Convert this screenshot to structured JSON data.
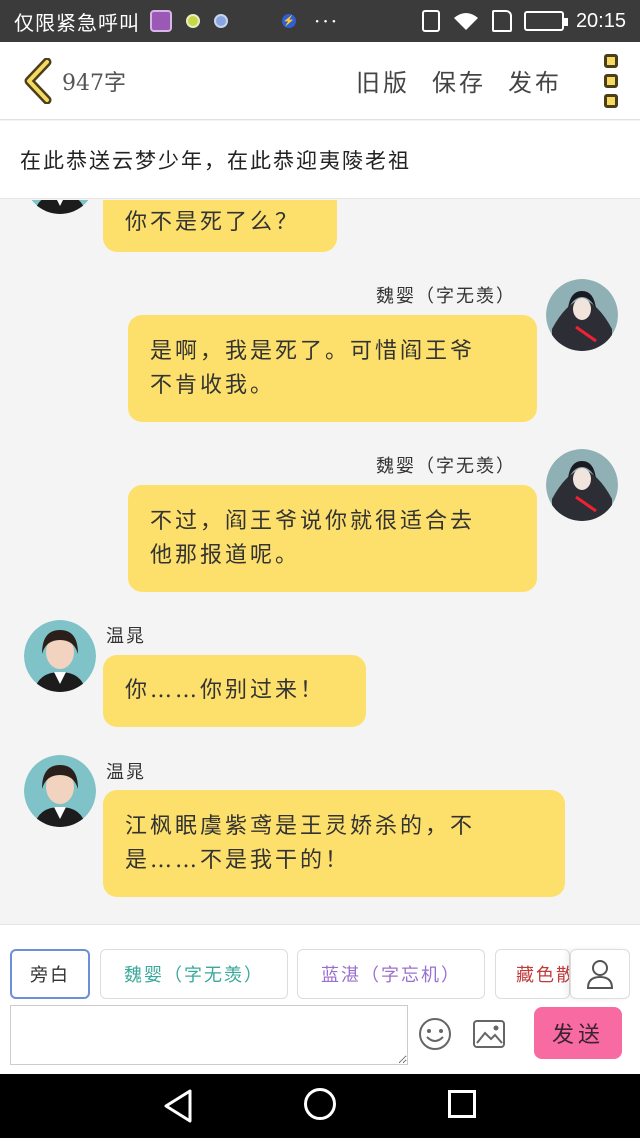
{
  "status_bar": {
    "emergency_text": "仅限紧急呼叫",
    "more": "···",
    "time": "20:15"
  },
  "header": {
    "word_count": "947字",
    "actions": [
      "旧版",
      "保存",
      "发布"
    ]
  },
  "subtitle": "在此恭送云梦少年，在此恭迎夷陵老祖",
  "messages": [
    {
      "side": "left",
      "name": "",
      "text_lines": [
        "你不是死了么？"
      ]
    },
    {
      "side": "right",
      "name": "魏婴（字无羡）",
      "text_lines": [
        "是啊，我是死了。可惜阎王爷",
        "不肯收我。"
      ]
    },
    {
      "side": "right",
      "name": "魏婴（字无羡）",
      "text_lines": [
        "不过，阎王爷说你就很适合去",
        "他那报道呢。"
      ]
    },
    {
      "side": "left",
      "name": "温晁",
      "text_lines": [
        "你……你别过来！"
      ]
    },
    {
      "side": "left",
      "name": "温晁",
      "text_lines": [
        "江枫眠虞紫鸢是王灵娇杀的，不",
        "是……不是我干的！"
      ]
    }
  ],
  "role_chips": [
    {
      "label": "旁白",
      "color": "#333333"
    },
    {
      "label": "魏婴（字无羡）",
      "color": "#3aa99a"
    },
    {
      "label": "蓝湛（字忘机）",
      "color": "#9a6fcf"
    },
    {
      "label": "藏色散",
      "color": "#c23a3a"
    }
  ],
  "input": {
    "placeholder": ""
  },
  "send_label": "发送",
  "colors": {
    "bubble": "#fde06b",
    "send": "#f76aa2",
    "accent_chip": "#6d8fd6"
  }
}
